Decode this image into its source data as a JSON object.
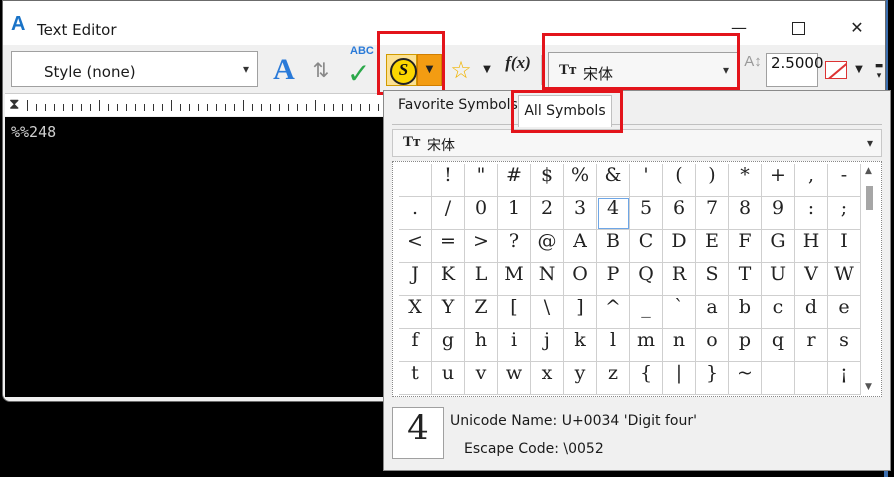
{
  "window": {
    "title": "Text Editor",
    "app_icon": "A",
    "min_glyph": "—",
    "close_glyph": "✕"
  },
  "toolbar": {
    "style_value": "Style (none)",
    "font_value": "宋体",
    "font_icon": "Tт",
    "text_height": "2.5000",
    "text_style_icon": "A",
    "spell_abc": "ABC",
    "fx_label": "f(x)",
    "symbol_letter": "S"
  },
  "ruler": {
    "marker": "⧗"
  },
  "editor": {
    "content": "%%248"
  },
  "symbols_panel": {
    "tab_favorite": "Favorite Symbols",
    "tab_all": "All Symbols",
    "font": "宋体",
    "grid": [
      [
        "",
        "!",
        "\"",
        "#",
        "$",
        "%",
        "&",
        "'",
        "(",
        ")",
        "*",
        "+",
        ",",
        "-"
      ],
      [
        ".",
        "/",
        "0",
        "1",
        "2",
        "3",
        "4",
        "5",
        "6",
        "7",
        "8",
        "9",
        ":",
        ";"
      ],
      [
        "<",
        "=",
        ">",
        "?",
        "@",
        "A",
        "B",
        "C",
        "D",
        "E",
        "F",
        "G",
        "H",
        "I"
      ],
      [
        "J",
        "K",
        "L",
        "M",
        "N",
        "O",
        "P",
        "Q",
        "R",
        "S",
        "T",
        "U",
        "V",
        "W"
      ],
      [
        "X",
        "Y",
        "Z",
        "[",
        "\\",
        "]",
        "^",
        "_",
        "`",
        "a",
        "b",
        "c",
        "d",
        "e"
      ],
      [
        "f",
        "g",
        "h",
        "i",
        "j",
        "k",
        "l",
        "m",
        "n",
        "o",
        "p",
        "q",
        "r",
        "s"
      ],
      [
        "t",
        "u",
        "v",
        "w",
        "x",
        "y",
        "z",
        "{",
        "|",
        "}",
        "~",
        "",
        "",
        "¡"
      ]
    ],
    "selected_symbol": "4",
    "unicode_name": "Unicode Name: U+0034 'Digit four'",
    "escape_code": "Escape Code: \\0052"
  },
  "colors": {
    "highlight": "#e3141b",
    "accent": "#f39c12",
    "symbol_yellow": "#fcd700",
    "editor_bg": "#000000"
  },
  "icons": {
    "text_style": "text-style-icon",
    "transfer": "transfer-style-icon",
    "spell": "spell-check-icon",
    "symbol": "insert-symbol-icon",
    "favorite": "star-icon",
    "field": "insert-field-icon",
    "height": "text-height-icon",
    "color": "no-color-icon"
  }
}
